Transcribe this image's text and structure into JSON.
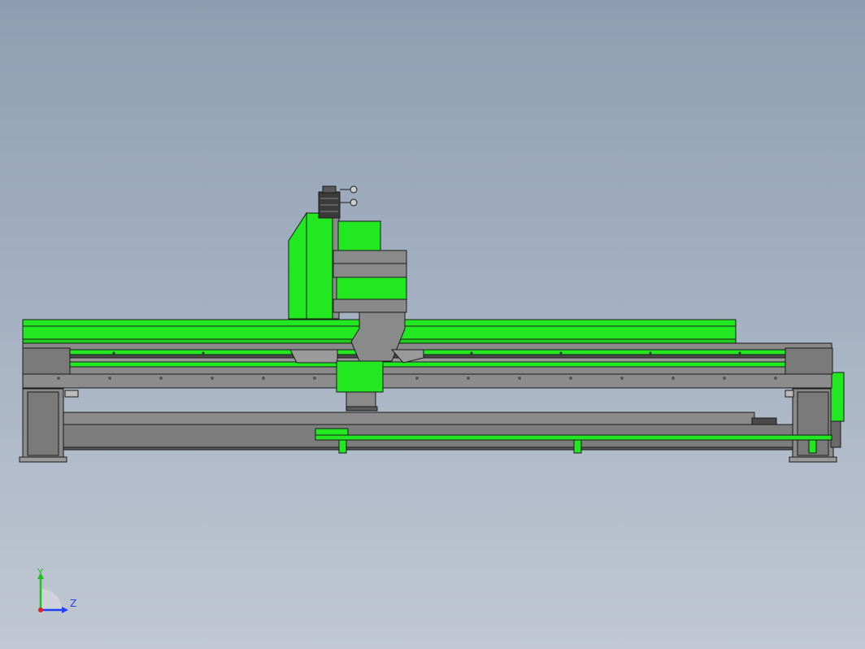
{
  "viewport": {
    "colors": {
      "accent_green": "#22e822",
      "steel_gray": "#8a8a8a",
      "dark_gray": "#5a5a5a",
      "outline": "#1a1a1a"
    }
  },
  "triad": {
    "y_label": "Y",
    "z_label": "Z",
    "colors": {
      "y": "#20c020",
      "z": "#2040ff",
      "x": "#e02020"
    }
  }
}
